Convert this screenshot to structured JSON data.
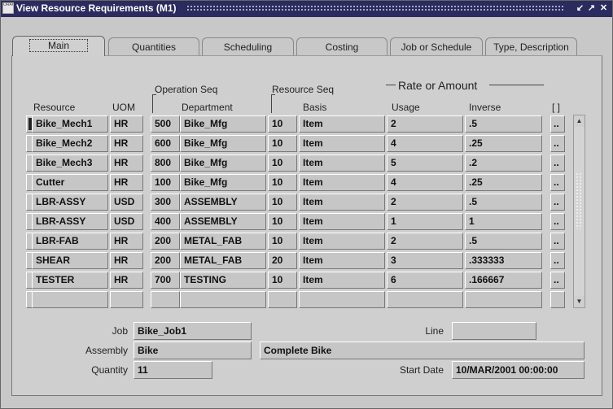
{
  "window": {
    "title": "View Resource Requirements (M1)",
    "app_icon_text": "ORACLE"
  },
  "tabs": [
    "Main",
    "Quantities",
    "Scheduling",
    "Costing",
    "Job or Schedule",
    "Type, Description"
  ],
  "group_headers": {
    "operation_seq": "Operation Seq",
    "resource_seq": "Resource Seq",
    "rate_or_amount": "Rate or Amount"
  },
  "columns": {
    "resource": "Resource",
    "uom": "UOM",
    "department": "Department",
    "basis": "Basis",
    "usage": "Usage",
    "inverse": "Inverse",
    "more": "[ ]"
  },
  "rows": [
    {
      "resource": "Bike_Mech1",
      "uom": "HR",
      "op_seq": "500",
      "department": "Bike_Mfg",
      "res_seq": "10",
      "basis": "Item",
      "usage": "2",
      "inverse": ".5",
      "more": ".."
    },
    {
      "resource": "Bike_Mech2",
      "uom": "HR",
      "op_seq": "600",
      "department": "Bike_Mfg",
      "res_seq": "10",
      "basis": "Item",
      "usage": "4",
      "inverse": ".25",
      "more": ".."
    },
    {
      "resource": "Bike_Mech3",
      "uom": "HR",
      "op_seq": "800",
      "department": "Bike_Mfg",
      "res_seq": "10",
      "basis": "Item",
      "usage": "5",
      "inverse": ".2",
      "more": ".."
    },
    {
      "resource": "Cutter",
      "uom": "HR",
      "op_seq": "100",
      "department": "Bike_Mfg",
      "res_seq": "10",
      "basis": "Item",
      "usage": "4",
      "inverse": ".25",
      "more": ".."
    },
    {
      "resource": "LBR-ASSY",
      "uom": "USD",
      "op_seq": "300",
      "department": "ASSEMBLY",
      "res_seq": "10",
      "basis": "Item",
      "usage": "2",
      "inverse": ".5",
      "more": ".."
    },
    {
      "resource": "LBR-ASSY",
      "uom": "USD",
      "op_seq": "400",
      "department": "ASSEMBLY",
      "res_seq": "10",
      "basis": "Item",
      "usage": "1",
      "inverse": "1",
      "more": ".."
    },
    {
      "resource": "LBR-FAB",
      "uom": "HR",
      "op_seq": "200",
      "department": "METAL_FAB",
      "res_seq": "10",
      "basis": "Item",
      "usage": "2",
      "inverse": ".5",
      "more": ".."
    },
    {
      "resource": "SHEAR",
      "uom": "HR",
      "op_seq": "200",
      "department": "METAL_FAB",
      "res_seq": "20",
      "basis": "Item",
      "usage": "3",
      "inverse": ".333333",
      "more": ".."
    },
    {
      "resource": "TESTER",
      "uom": "HR",
      "op_seq": "700",
      "department": "TESTING",
      "res_seq": "10",
      "basis": "Item",
      "usage": "6",
      "inverse": ".166667",
      "more": ".."
    },
    {
      "resource": "",
      "uom": "",
      "op_seq": "",
      "department": "",
      "res_seq": "",
      "basis": "",
      "usage": "",
      "inverse": "",
      "more": ""
    }
  ],
  "footer": {
    "job_label": "Job",
    "job_value": "Bike_Job1",
    "line_label": "Line",
    "line_value": "",
    "assembly_label": "Assembly",
    "assembly_value": "Bike",
    "assembly_desc": "Complete Bike",
    "quantity_label": "Quantity",
    "quantity_value": "11",
    "start_date_label": "Start Date",
    "start_date_value": "10/MAR/2001 00:00:00"
  },
  "icons": {
    "minimize": "minimize-icon",
    "maximize": "maximize-icon",
    "close": "close-icon",
    "scroll_up": "arrow-up-icon",
    "scroll_down": "arrow-down-icon"
  }
}
